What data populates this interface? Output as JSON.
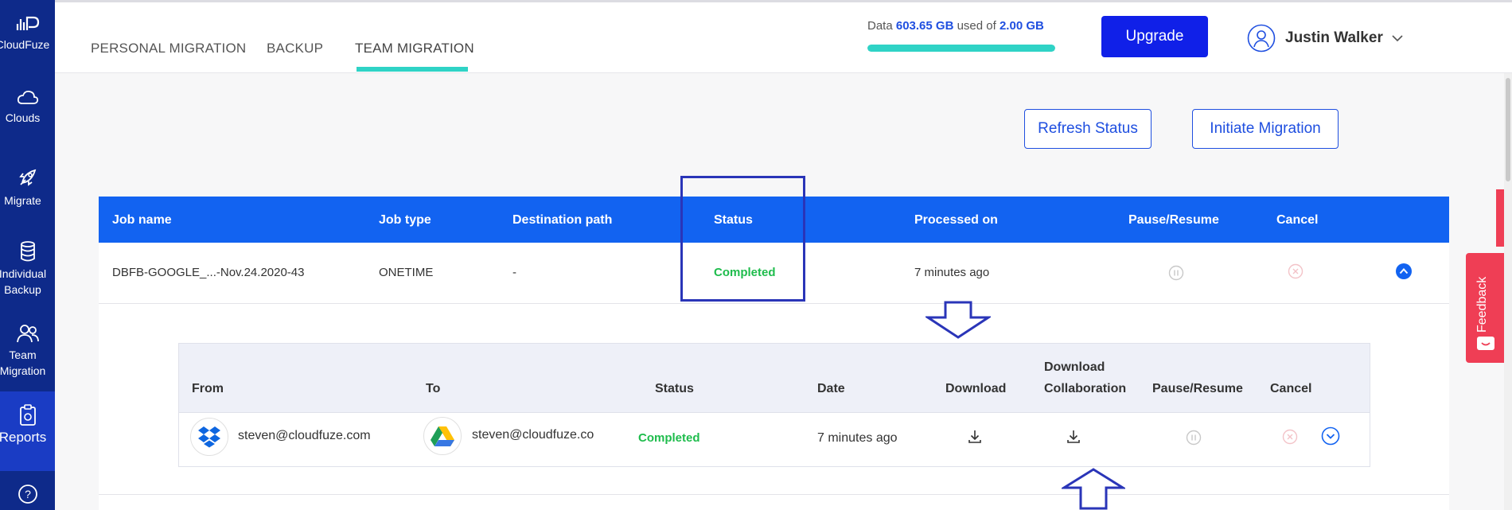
{
  "sidebar": {
    "items": [
      {
        "label": "CloudFuze",
        "icon": "cloudfuze-logo-icon"
      },
      {
        "label": "Clouds",
        "icon": "cloud-icon"
      },
      {
        "label": "Migrate",
        "icon": "rocket-icon"
      },
      {
        "label": "Individual",
        "label2": "Backup",
        "icon": "database-icon"
      },
      {
        "label": "Team",
        "label2": "Migration",
        "icon": "team-icon"
      },
      {
        "label": "Reports",
        "icon": "reports-icon"
      },
      {
        "label": "",
        "icon": "help-icon"
      }
    ]
  },
  "tabs": [
    {
      "label": "PERSONAL MIGRATION"
    },
    {
      "label": "BACKUP"
    },
    {
      "label": "TEAM MIGRATION"
    }
  ],
  "usage": {
    "prefix": "Data",
    "used": "603.65 GB",
    "middle": "used of",
    "total": "2.00 GB",
    "fill_fraction": 1.0
  },
  "upgrade_label": "Upgrade",
  "user": {
    "name": "Justin Walker"
  },
  "actions": {
    "refresh": "Refresh Status",
    "initiate": "Initiate Migration"
  },
  "jobs": {
    "headers": [
      "Job name",
      "Job type",
      "Destination path",
      "Status",
      "Processed on",
      "Pause/Resume",
      "Cancel"
    ],
    "row": {
      "name": "DBFB-GOOGLE_...-Nov.24.2020-43",
      "type": "ONETIME",
      "dest": "-",
      "status": "Completed",
      "processed": "7 minutes ago"
    }
  },
  "details": {
    "headers": [
      "From",
      "To",
      "Status",
      "Date",
      "Download",
      "Download",
      "Collaboration",
      "Pause/Resume",
      "Cancel"
    ],
    "row": {
      "from": "steven@cloudfuze.com",
      "to": "steven@cloudfuze.co",
      "status": "Completed",
      "date": "7 minutes ago"
    }
  },
  "feedback_label": "Feedback",
  "colors": {
    "accent": "#1263f1",
    "sidebar": "#0e2a8a",
    "success": "#1ebc4c",
    "teal": "#2fd3c6",
    "annotation": "#2a35b8"
  }
}
